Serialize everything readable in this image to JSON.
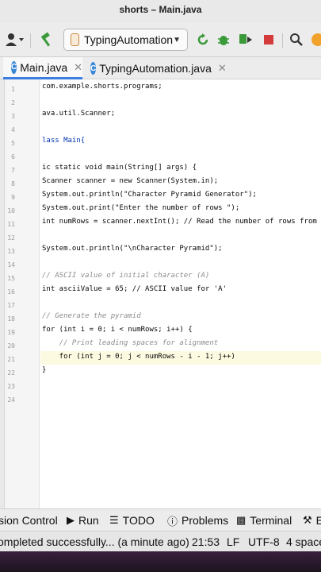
{
  "window": {
    "title": "shorts – Main.java"
  },
  "toolbar": {
    "run_config_label": "TypingAutomation",
    "icons": [
      "user-icon",
      "hammer-icon",
      "run-icon",
      "debug-icon",
      "coverage-icon",
      "stop-icon",
      "search-icon",
      "update-icon"
    ]
  },
  "tabs": [
    {
      "label": "Main.java",
      "icon": "C",
      "active": true
    },
    {
      "label": "TypingAutomation.java",
      "icon": "C",
      "active": false
    }
  ],
  "editor": {
    "line_numbers": [
      "1",
      "2",
      "3",
      "4",
      "5",
      "6",
      "7",
      "8",
      "9",
      "10",
      "11",
      "12",
      "13",
      "14",
      "15",
      "16",
      "17",
      "18",
      "19",
      "20",
      "21",
      "22",
      "23",
      "24"
    ],
    "lines": [
      "com.example.shorts.programs;",
      "",
      "ava.util.Scanner;",
      "",
      "lass Main{",
      "",
      "ic static void main(String[] args) {",
      "Scanner scanner = new Scanner(System.in);",
      "System.out.println(\"Character Pyramid Generator\");",
      "System.out.print(\"Enter the number of rows \");",
      "int numRows = scanner.nextInt(); // Read the number of rows from the use",
      "",
      "System.out.println(\"\\nCharacter Pyramid\");",
      "",
      "// ASCII value of initial character (A)",
      "int asciiValue = 65; // ASCII value for 'A'",
      "",
      "// Generate the pyramid",
      "for (int i = 0; i < numRows; i++) {",
      "    // Print leading spaces for alignment",
      "    for (int j = 0; j < numRows - i - 1; j++)",
      "}",
      "",
      ""
    ],
    "current_line": 21
  },
  "tool_windows": [
    {
      "label": "sion Control",
      "icon": ""
    },
    {
      "label": "Run",
      "icon": "run-icon"
    },
    {
      "label": "TODO",
      "icon": "todo-icon"
    },
    {
      "label": "Problems",
      "icon": "problems-icon"
    },
    {
      "label": "Terminal",
      "icon": "terminal-icon"
    },
    {
      "label": "E",
      "icon": "build-icon"
    }
  ],
  "status": {
    "message": "ompleted successfully... (a minute ago)",
    "position": "21:53",
    "line_separator": "LF",
    "encoding": "UTF-8",
    "indent": "4 space"
  },
  "colors": {
    "accent": "#3d7fe0",
    "keyword": "#0033b3",
    "string": "#067d17",
    "comment": "#8c8c8c",
    "number": "#1750eb"
  }
}
